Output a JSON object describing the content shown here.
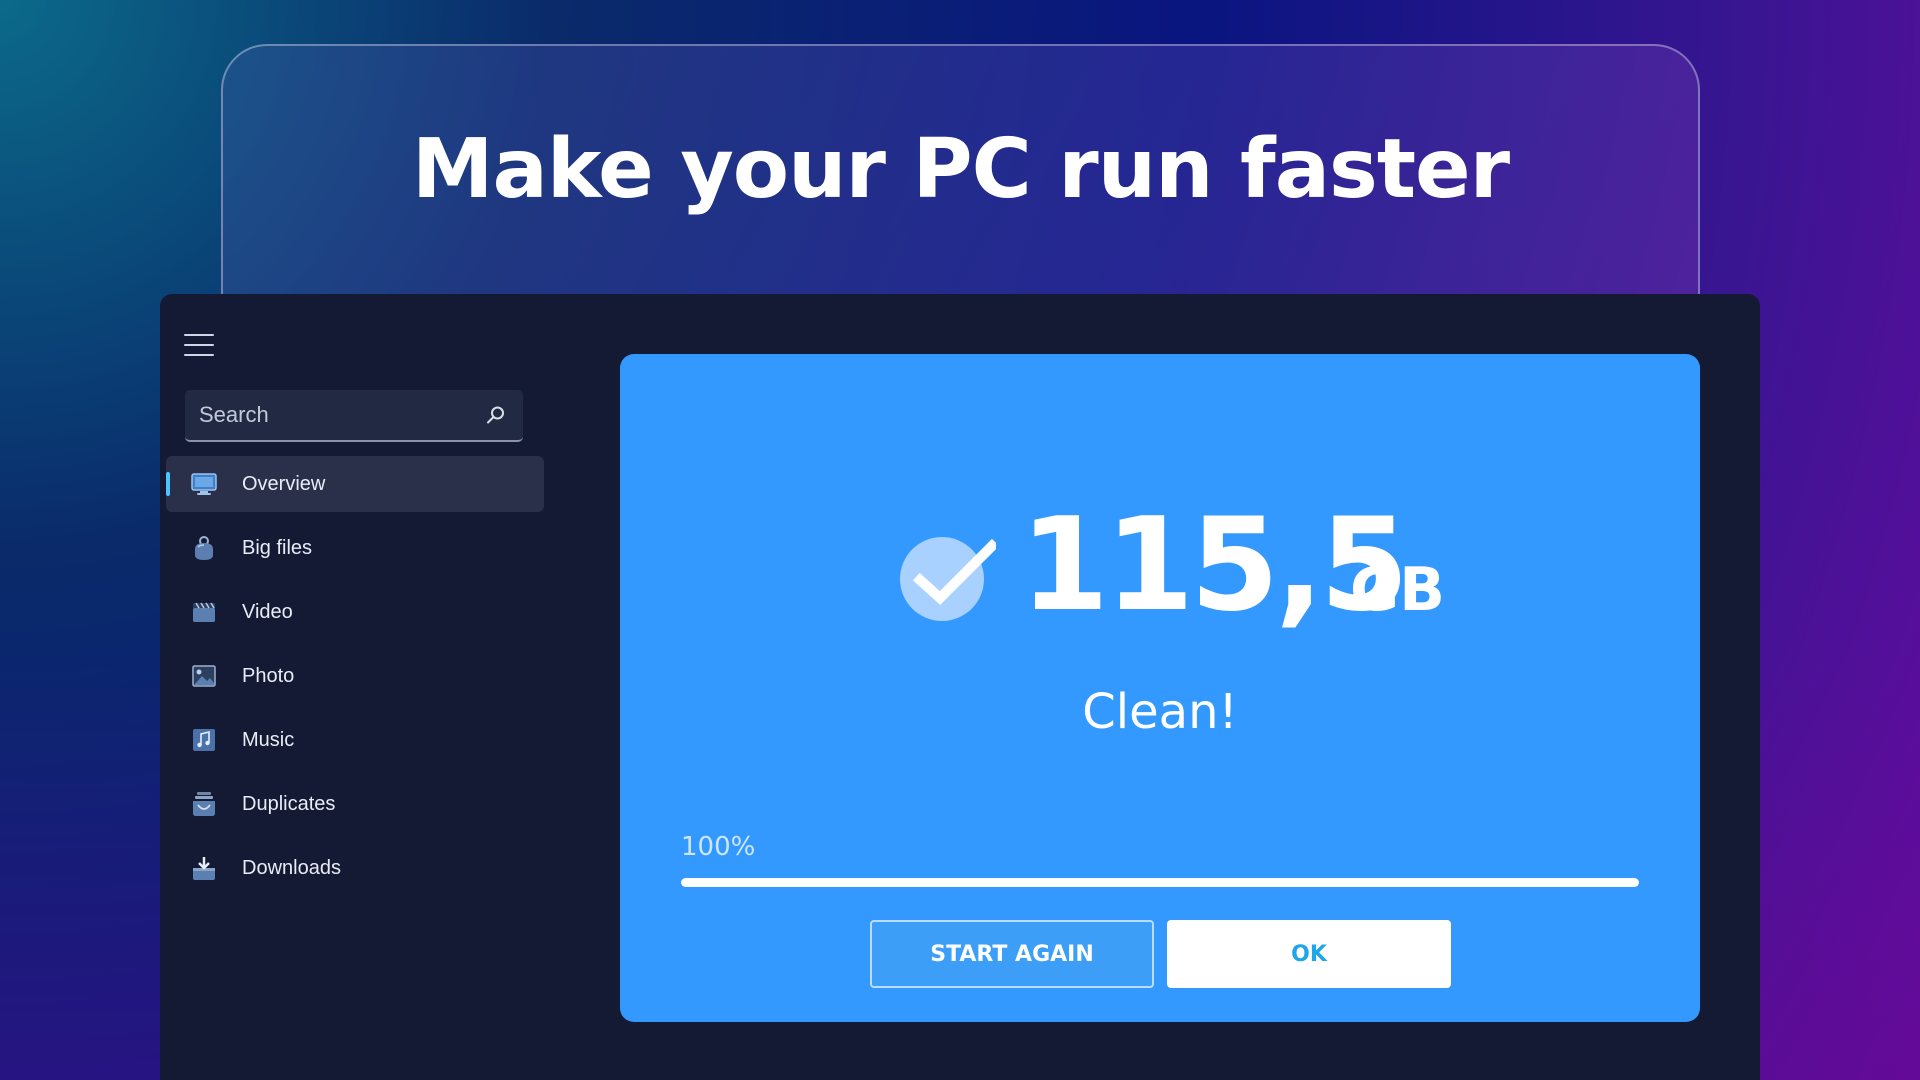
{
  "banner": {
    "headline": "Make your PC run faster"
  },
  "sidebar": {
    "search_placeholder": "Search",
    "items": [
      {
        "label": "Overview",
        "icon": "monitor-icon",
        "active": true
      },
      {
        "label": "Big files",
        "icon": "weight-icon",
        "active": false
      },
      {
        "label": "Video",
        "icon": "clapperboard-icon",
        "active": false
      },
      {
        "label": "Photo",
        "icon": "picture-icon",
        "active": false
      },
      {
        "label": "Music",
        "icon": "music-note-icon",
        "active": false
      },
      {
        "label": "Duplicates",
        "icon": "stacked-copies-icon",
        "active": false
      },
      {
        "label": "Downloads",
        "icon": "download-tray-icon",
        "active": false
      }
    ]
  },
  "result": {
    "value": "115,5",
    "unit": "GB",
    "status": "Clean!",
    "progress_label": "100%",
    "progress_fraction": 1.0,
    "start_again_label": "START AGAIN",
    "ok_label": "OK"
  },
  "colors": {
    "accent": "#3399ff",
    "window_bg": "#141a33",
    "active_indicator": "#4cc2ff",
    "ok_text": "#1ea7e8"
  }
}
